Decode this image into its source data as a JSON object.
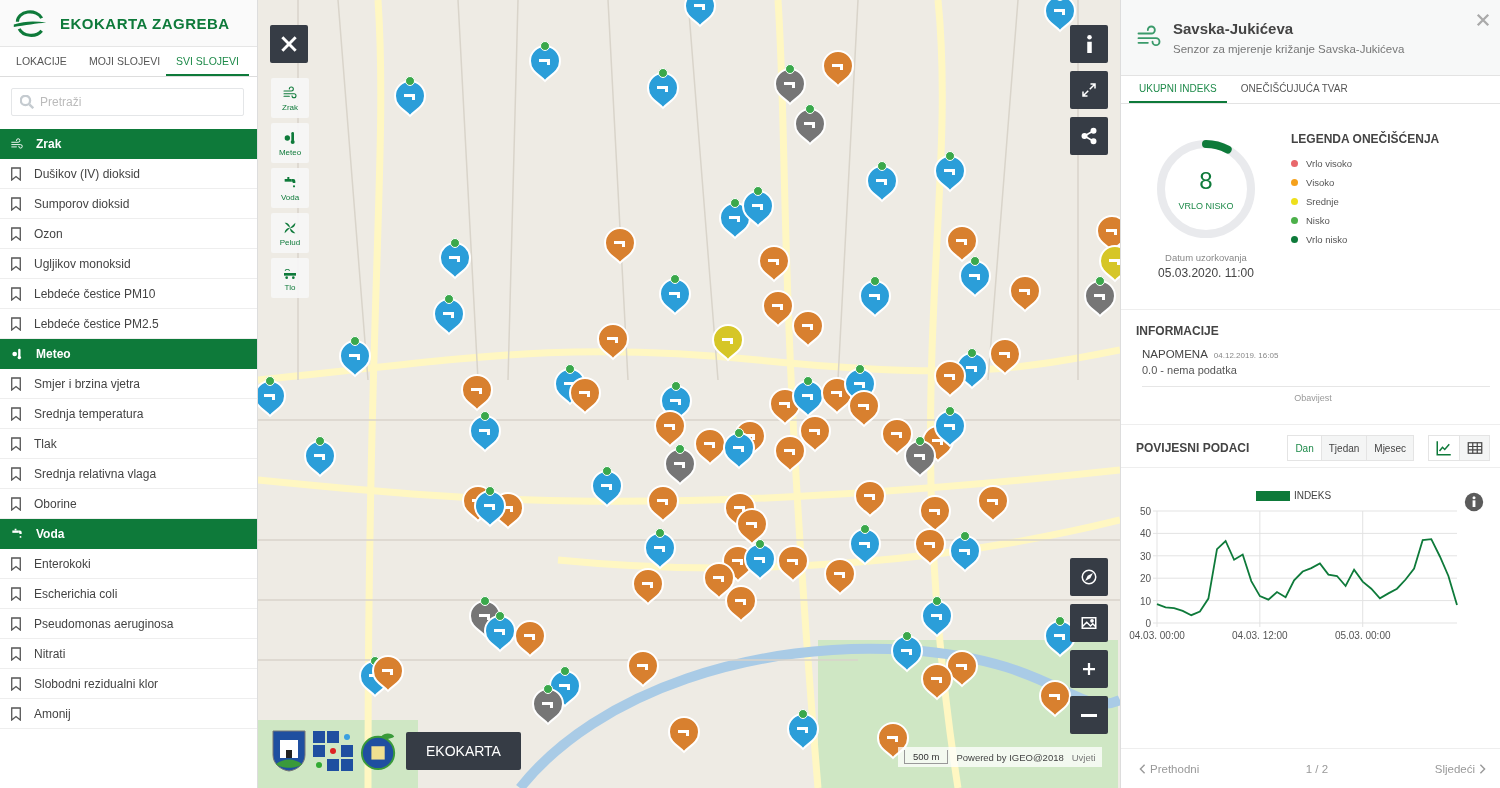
{
  "header": {
    "title": "EKOKARTA ZAGREBA"
  },
  "tabs": [
    {
      "label": "LOKACIJE",
      "selected": false
    },
    {
      "label": "MOJI SLOJEVI",
      "selected": false
    },
    {
      "label": "SVI SLOJEVI",
      "selected": true
    }
  ],
  "search": {
    "placeholder": "Pretraži"
  },
  "layer_groups": [
    {
      "label": "Zrak",
      "kind": "air",
      "items": [
        "Dušikov (IV) dioksid",
        "Sumporov dioksid",
        "Ozon",
        "Ugljikov monoksid",
        "Lebdeće čestice PM10",
        "Lebdeće čestice PM2.5"
      ]
    },
    {
      "label": "Meteo",
      "kind": "meteo",
      "items": [
        "Smjer i brzina vjetra",
        "Srednja temperatura",
        "Tlak",
        "Srednja relativna vlaga",
        "Oborine"
      ]
    },
    {
      "label": "Voda",
      "kind": "water",
      "items": [
        "Enterokoki",
        "Escherichia coli",
        "Pseudomonas aeruginosa",
        "Nitrati",
        "Slobodni rezidualni klor",
        "Amonij"
      ]
    }
  ],
  "map": {
    "category_buttons": [
      {
        "label": "Zrak",
        "kind": "air"
      },
      {
        "label": "Meteo",
        "kind": "meteo"
      },
      {
        "label": "Voda",
        "kind": "water"
      },
      {
        "label": "Pelud",
        "kind": "pollen"
      },
      {
        "label": "Tlo",
        "kind": "soil"
      }
    ],
    "top_tools": [
      {
        "kind": "info"
      },
      {
        "kind": "expand"
      },
      {
        "kind": "share"
      }
    ],
    "bottom_tools": [
      {
        "kind": "compass"
      },
      {
        "kind": "image"
      },
      {
        "kind": "plus"
      },
      {
        "kind": "minus"
      }
    ],
    "brand_button": "EKOKARTA",
    "scale": "500 m",
    "attribution": "Powered by IGEO@2018",
    "terms": "Uvjeti"
  },
  "panel": {
    "title": "Savska-Jukićeva",
    "subtitle": "Senzor za mjerenje križanje Savska-Jukićeva",
    "tabs": [
      {
        "label": "UKUPNI INDEKS",
        "selected": true
      },
      {
        "label": "ONEČIŠĆUJUĆA TVAR",
        "selected": false
      }
    ],
    "gauge": {
      "value": "8",
      "label": "VRLO NISKO",
      "level": 0.08,
      "date_label": "Datum uzorkovanja",
      "date": "05.03.2020. 11:00"
    },
    "legend": {
      "title": "LEGENDA ONEČIŠĆENJA",
      "items": [
        {
          "label": "Vrlo visoko",
          "color": "#e8676b"
        },
        {
          "label": "Visoko",
          "color": "#f5a11c"
        },
        {
          "label": "Srednje",
          "color": "#eee01c"
        },
        {
          "label": "Nisko",
          "color": "#4cb04a"
        },
        {
          "label": "Vrlo nisko",
          "color": "#0e7a3a"
        }
      ]
    },
    "info": {
      "title": "INFORMACIJE",
      "note_title": "NAPOMENA",
      "note_date": "04.12.2019. 16:05",
      "note_text": "0.0 - nema podatka",
      "footer": "Obavijest"
    },
    "history": {
      "title": "POVIJESNI PODACI",
      "periods": [
        {
          "label": "Dan",
          "selected": true
        },
        {
          "label": "Tjedan",
          "selected": false
        },
        {
          "label": "Mjesec",
          "selected": false
        }
      ],
      "views": [
        {
          "kind": "chart",
          "selected": true
        },
        {
          "kind": "table",
          "selected": false
        }
      ],
      "chart_data": {
        "type": "line",
        "categories": [
          "04.03. 00:00",
          null,
          null,
          null,
          null,
          null,
          null,
          null,
          null,
          null,
          null,
          null,
          "04.03. 12:00",
          null,
          null,
          null,
          null,
          null,
          null,
          null,
          null,
          null,
          null,
          null,
          "05.03. 00:00",
          null,
          null,
          null,
          null,
          null,
          null,
          null,
          null,
          null,
          null,
          null
        ],
        "series": [
          {
            "name": "INDEKS",
            "color": "#0e7a3a",
            "values": [
              8.4,
              7,
              6.6,
              5.4,
              3.5,
              5.1,
              10.9,
              33,
              36.6,
              28.2,
              30.6,
              18.7,
              12,
              10.4,
              13.8,
              11.5,
              19,
              23,
              24.5,
              26.6,
              21.6,
              21,
              16.5,
              23.8,
              18.5,
              15.3,
              11,
              13.2,
              15.3,
              19.4,
              24.3,
              37,
              37.4,
              29.7,
              21,
              8
            ]
          }
        ],
        "ylim": [
          0,
          50
        ],
        "yticks": [
          0,
          10,
          20,
          30,
          40,
          50
        ],
        "grid": true
      }
    },
    "pager": {
      "prev": "Prethodni",
      "position": "1 / 2",
      "next": "Sljedeći"
    }
  }
}
